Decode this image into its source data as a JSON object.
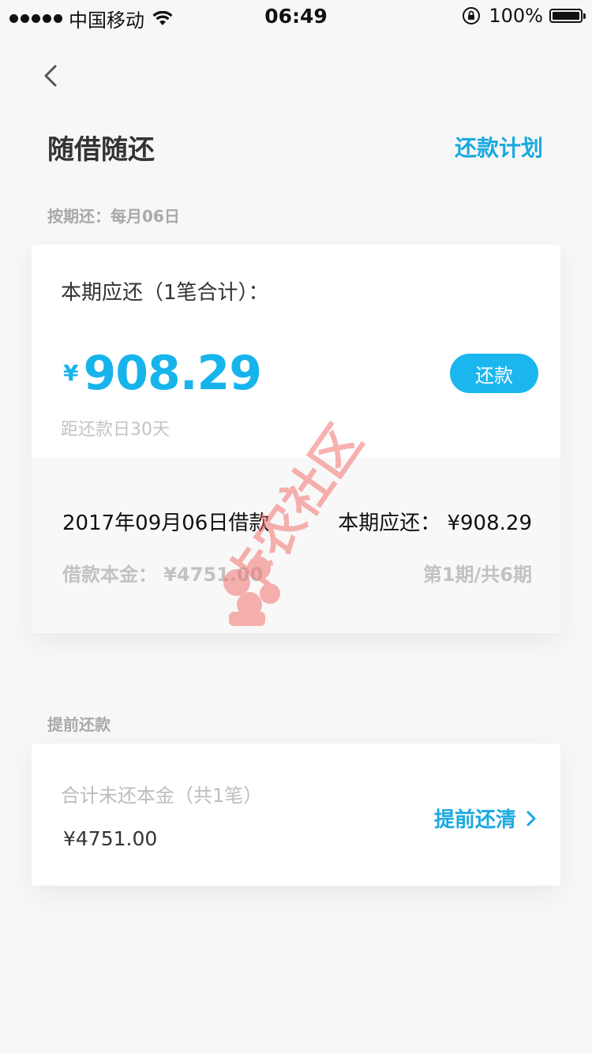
{
  "status_bar": {
    "carrier": "中国移动",
    "time": "06:49",
    "battery": "100%"
  },
  "header": {
    "title": "随借随还",
    "plan_link": "还款计划"
  },
  "installment": {
    "section_label": "按期还：每月06日",
    "due_label": "本期应还（1笔合计）：",
    "currency": "¥",
    "amount": "908.29",
    "repay_button": "还款",
    "days_left": "距还款日30天",
    "loan_date": "2017年09月06日借款",
    "current_due": "本期应还： ¥908.29",
    "principal": "借款本金： ¥4751.00",
    "period": "第1期/共6期"
  },
  "prepayment": {
    "section_label": "提前还款",
    "unpaid_label": "合计未还本金（共1笔）",
    "unpaid_amount": "¥4751.00",
    "prepay_link": "提前还清"
  },
  "watermark_text": "卡农社区",
  "colors": {
    "accent": "#1cb6ef",
    "link": "#1aa9df",
    "watermark": "#f27470"
  }
}
